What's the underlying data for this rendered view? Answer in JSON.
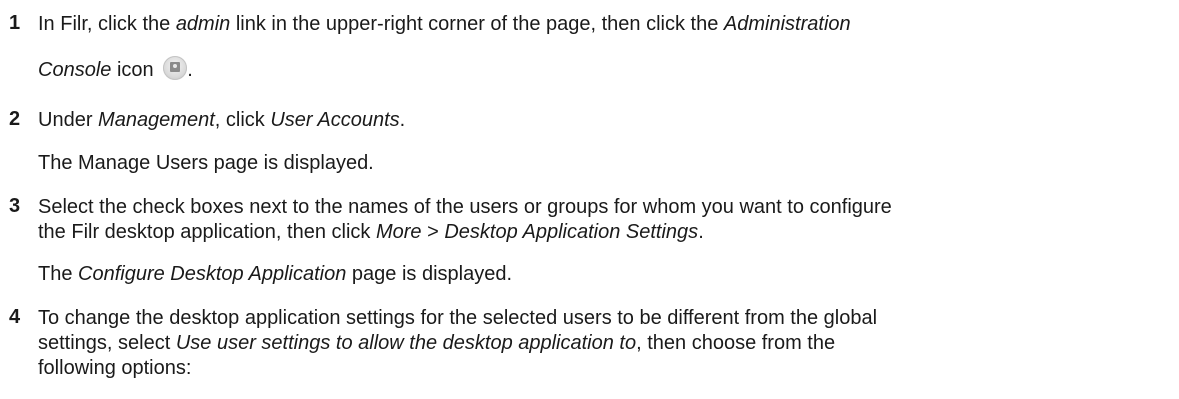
{
  "steps": [
    {
      "number": "1",
      "line1": {
        "t1": "In Filr, click the ",
        "i1": "admin",
        "t2": " link in the upper-right corner of the page, then click the ",
        "i2": "Administration"
      },
      "line2": {
        "i1": "Console",
        "t1": " icon ",
        "t2": "."
      },
      "icon": "administration-console-icon"
    },
    {
      "number": "2",
      "line1": {
        "t1": "Under ",
        "i1": "Management",
        "t2": ", click ",
        "i2": "User Accounts",
        "t3": "."
      },
      "result": "The Manage Users page is displayed."
    },
    {
      "number": "3",
      "line1": "Select the check boxes next to the names of the users or groups for whom you want to configure",
      "line2": {
        "t1": "the Filr desktop application, then click ",
        "i1": "More",
        "t2": " > ",
        "i2": "Desktop Application Settings",
        "t3": "."
      },
      "result": {
        "t1": "The ",
        "i1": "Configure Desktop Application",
        "t2": " page is displayed."
      }
    },
    {
      "number": "4",
      "line1": "To change the desktop application settings for the selected users to be different from the global",
      "line2": {
        "t1": "settings, select ",
        "i1": "Use user settings to allow the desktop application to",
        "t2": ", then choose from the"
      },
      "line3": "following options:"
    }
  ]
}
